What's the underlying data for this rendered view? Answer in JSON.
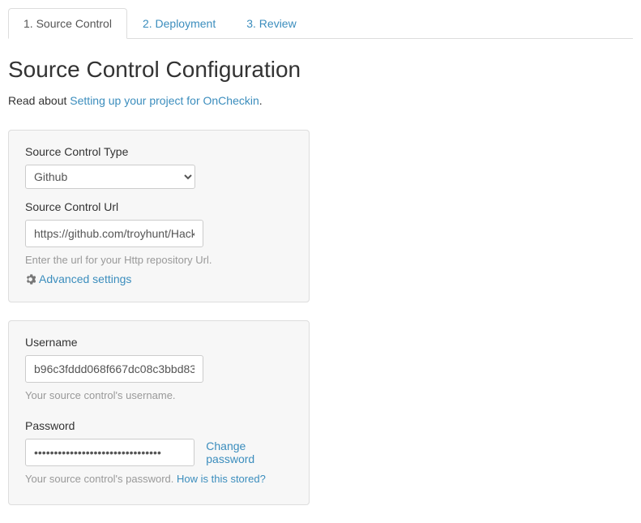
{
  "tabs": [
    {
      "label": "1. Source Control",
      "active": true
    },
    {
      "label": "2. Deployment",
      "active": false
    },
    {
      "label": "3. Review",
      "active": false
    }
  ],
  "page_title": "Source Control Configuration",
  "intro": {
    "prefix": "Read about ",
    "link_text": "Setting up your project for OnCheckin",
    "suffix": "."
  },
  "panel1": {
    "type_label": "Source Control Type",
    "type_value": "Github",
    "url_label": "Source Control Url",
    "url_value": "https://github.com/troyhunt/HackYourselfFirst",
    "url_help": "Enter the url for your Http repository Url.",
    "advanced_label": "Advanced settings"
  },
  "panel2": {
    "username_label": "Username",
    "username_value": "b96c3fddd068f667dc08c3bbd83",
    "username_help": "Your source control's username.",
    "password_label": "Password",
    "password_value": "••••••••••••••••••••••••••••••••",
    "change_password_label": "Change password",
    "password_help_prefix": "Your source control's password. ",
    "password_help_link": "How is this stored?"
  }
}
